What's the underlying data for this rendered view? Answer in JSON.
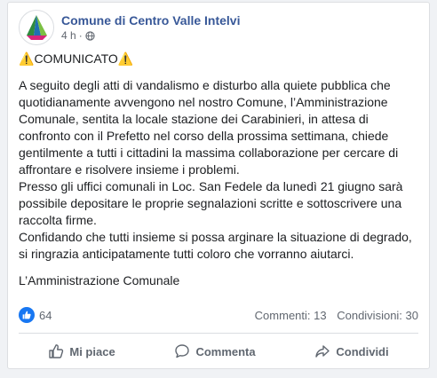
{
  "post": {
    "page_name": "Comune di Centro Valle Intelvi",
    "time": "4 h",
    "separator": "·",
    "headline_icon": "⚠️",
    "headline": "COMUNICATO",
    "paragraphs": [
      "A seguito degli atti di vandalismo e disturbo alla quiete pubblica che quotidianamente avvengono nel nostro Comune, l’Amministrazione Comunale, sentita la locale stazione dei Carabinieri, in attesa di confronto con il Prefetto nel corso della prossima settimana, chiede gentilmente a tutti i cittadini la massima collaborazione per cercare di affrontare e risolvere insieme i problemi.",
      "Presso gli uffici comunali in Loc. San Fedele da lunedì 21 giugno sarà possibile depositare le proprie segnalazioni scritte e sottoscrivere una raccolta firme.",
      "Confidando che tutti insieme si possa arginare la situazione di degrado, si ringrazia anticipatamente tutti coloro che vorranno aiutarci."
    ],
    "signature": "L’Amministrazione Comunale"
  },
  "stats": {
    "likes": "64",
    "comments": "Commenti: 13",
    "shares": "Condivisioni: 30"
  },
  "actions": {
    "like": "Mi piace",
    "comment": "Commenta",
    "share": "Condividi"
  },
  "colors": {
    "page_name": "#385898",
    "like_blue": "#1877f2"
  },
  "icons": {
    "avatar": "municipality-logo-icon",
    "privacy": "globe-icon",
    "reaction": "like-reaction-icon",
    "like_action": "thumbs-up-icon",
    "comment_action": "comment-icon",
    "share_action": "share-arrow-icon"
  }
}
